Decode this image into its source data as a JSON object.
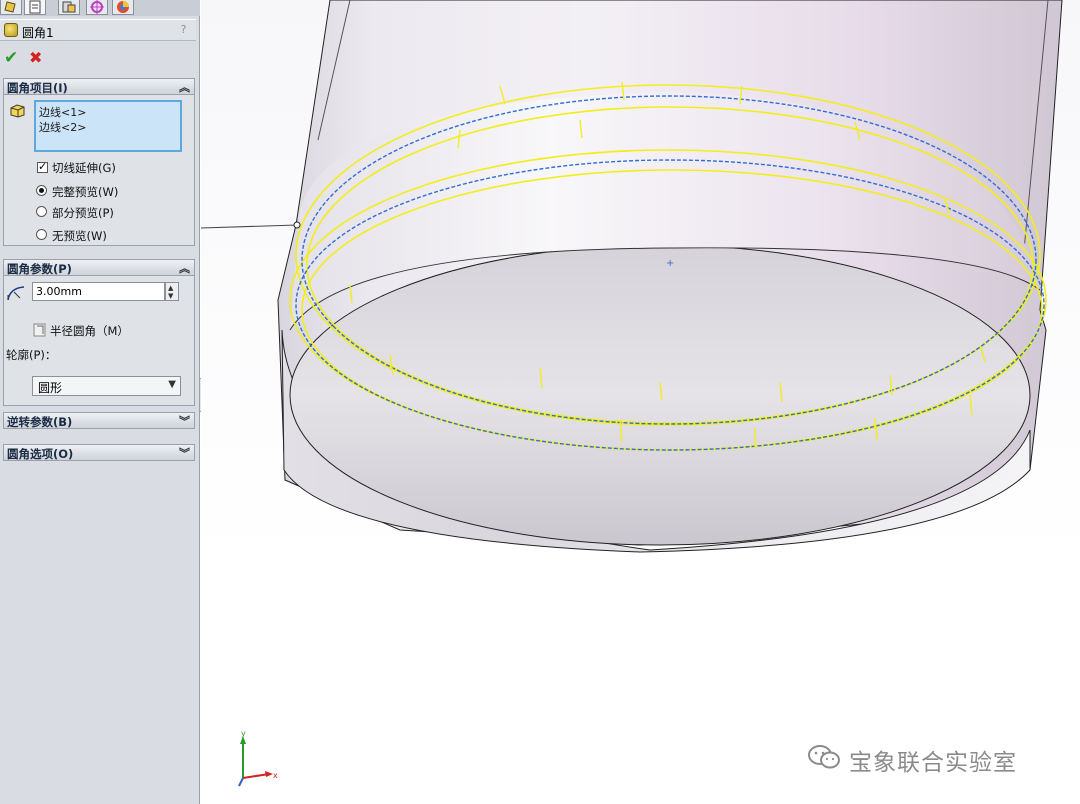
{
  "feature": {
    "title": "圆角1",
    "help": "?"
  },
  "actions": {
    "ok": "✔",
    "cancel": "✖"
  },
  "groups": {
    "items": {
      "title": "圆角项目(I)",
      "selections": [
        "边线<1>",
        "边线<2>"
      ],
      "tangent_propagation": "切线延伸(G)",
      "preview_options": [
        "完整预览(W)",
        "部分预览(P)",
        "无预览(W)"
      ],
      "preview_selected": "完整预览(W)"
    },
    "params": {
      "title": "圆角参数(P)",
      "radius_value": "3.00mm",
      "multiple_radius": "半径圆角（M）",
      "profile_label": "轮廓(P)：",
      "profile_value": "圆形"
    },
    "setback": {
      "title": "逆转参数(B)"
    },
    "options": {
      "title": "圆角选项(O)"
    }
  },
  "chevrons": {
    "up": "︽",
    "down": "︾"
  },
  "watermark": {
    "text": "宝象联合实验室"
  },
  "triad": {
    "x": "x",
    "y": "y"
  },
  "colors": {
    "selection_yellow": "#f2ee1c",
    "edge_blue": "#2e6fd6",
    "panel_bg": "#d9dde3",
    "list_bg": "#cce4f7"
  }
}
